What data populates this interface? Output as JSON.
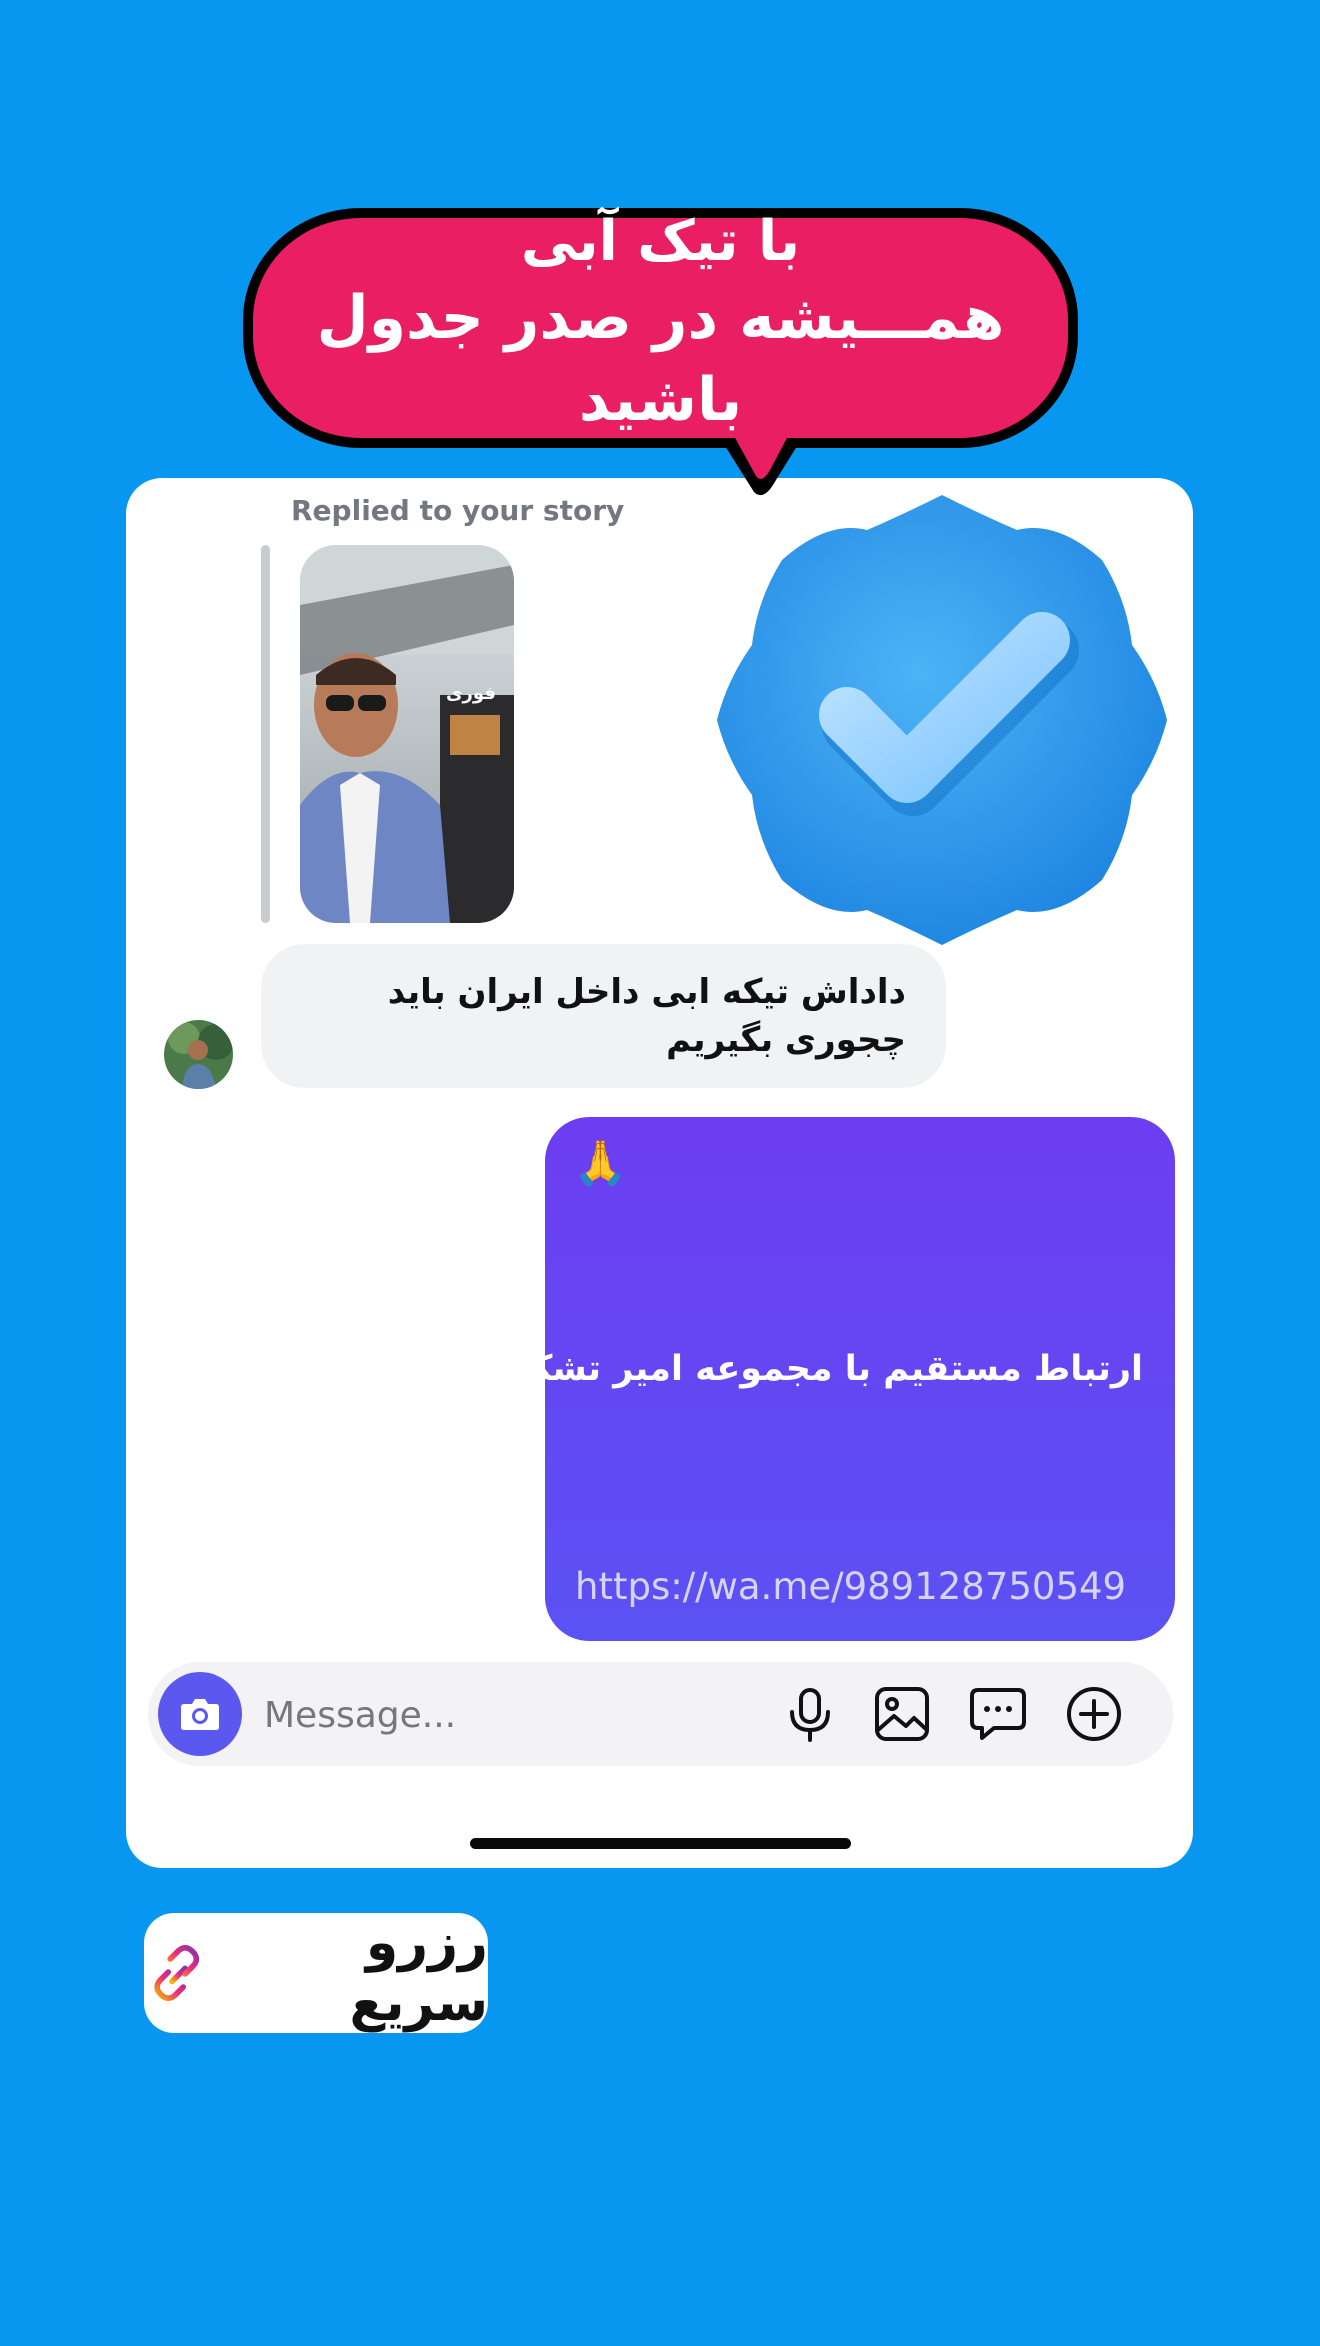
{
  "banner": {
    "line1": "با تیک آبی",
    "line2": "همـــیشه در صدر جدول باشید"
  },
  "story": {
    "replied_label": "Replied to your story",
    "caption": "فوری"
  },
  "messages": {
    "incoming_text": "داداش تیکه ابی داخل ایران باید چجوری بگیریم",
    "outgoing_emoji": "🙏",
    "outgoing_text": "ارتباط مستقیم با مجموعه امیر تشکر",
    "outgoing_link": "https://wa.me/989128750549"
  },
  "composer": {
    "placeholder": "Message..."
  },
  "quick_action": {
    "label": "رزرو سریع"
  },
  "colors": {
    "background": "#0897f0",
    "banner": "#ea1f63",
    "outgoing_bubble": "#6c3df2",
    "camera_button": "#5b58ef",
    "badge": "#2a9cf0"
  },
  "icons": [
    "camera-icon",
    "microphone-icon",
    "gallery-icon",
    "sticker-chat-icon",
    "plus-icon",
    "link-icon",
    "verified-badge-icon"
  ]
}
